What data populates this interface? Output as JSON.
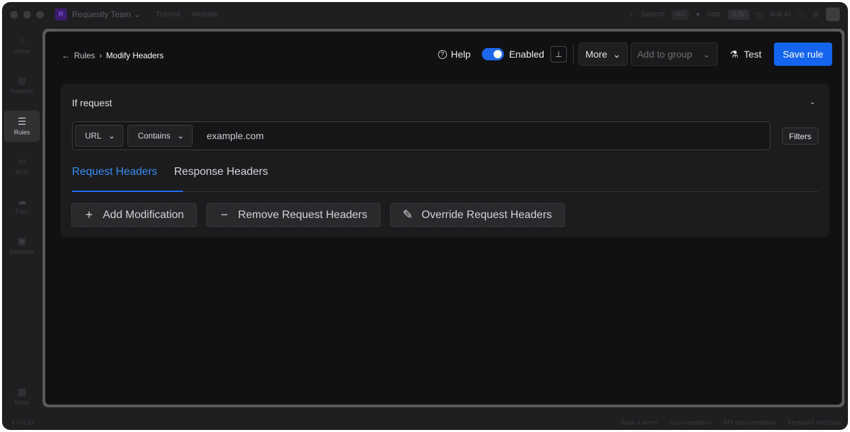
{
  "titlebar": {
    "workspace_initial": "R",
    "workspace_name": "Requestly Team",
    "links": [
      "Tutorial",
      "Website"
    ],
    "search_label": "Search",
    "search_shortcut": "⌘K",
    "star_label": "Star",
    "star_count": "3.2k",
    "ask_ai_label": "Ask AI"
  },
  "sidebar": {
    "items": [
      {
        "label": "Home",
        "icon": "home-icon",
        "glyph": "⌂"
      },
      {
        "label": "Network",
        "icon": "globe-icon",
        "glyph": "◍"
      },
      {
        "label": "Rules",
        "icon": "sliders-icon",
        "glyph": "☰"
      },
      {
        "label": "APIs",
        "icon": "link-icon",
        "glyph": "∞"
      },
      {
        "label": "Files",
        "icon": "cloud-icon",
        "glyph": "☁"
      },
      {
        "label": "Sessions",
        "icon": "video-icon",
        "glyph": "▣"
      }
    ],
    "bottom_label": "Invite"
  },
  "breadcrumb": {
    "back_arrow": "←",
    "parent": "Rules",
    "separator": "›",
    "current": "Modify Headers"
  },
  "actions": {
    "help_label": "Help",
    "enabled_label": "Enabled",
    "enabled_state": true,
    "more_label": "More",
    "add_to_group_placeholder": "Add to group",
    "test_label": "Test",
    "save_label": "Save rule"
  },
  "condition": {
    "title": "If request",
    "source_key": "URL",
    "operator": "Contains",
    "value": "example.com",
    "filters_label": "Filters"
  },
  "tabs": [
    {
      "label": "Request Headers",
      "active": true
    },
    {
      "label": "Response Headers",
      "active": false
    }
  ],
  "modifications": [
    {
      "label": "Add Modification",
      "glyph": "+"
    },
    {
      "label": "Remove Request Headers",
      "glyph": "−"
    },
    {
      "label": "Override Request Headers",
      "glyph": "✎"
    }
  ],
  "footer": {
    "version": "v 0.0.33",
    "links": [
      "Book a demo",
      "Documentation",
      "API documentation",
      "Keyboard shortcuts"
    ]
  },
  "colors": {
    "accent": "#1464ef",
    "tab_active": "#3a8df5",
    "background": "#111113",
    "card": "#1c1c1e"
  }
}
